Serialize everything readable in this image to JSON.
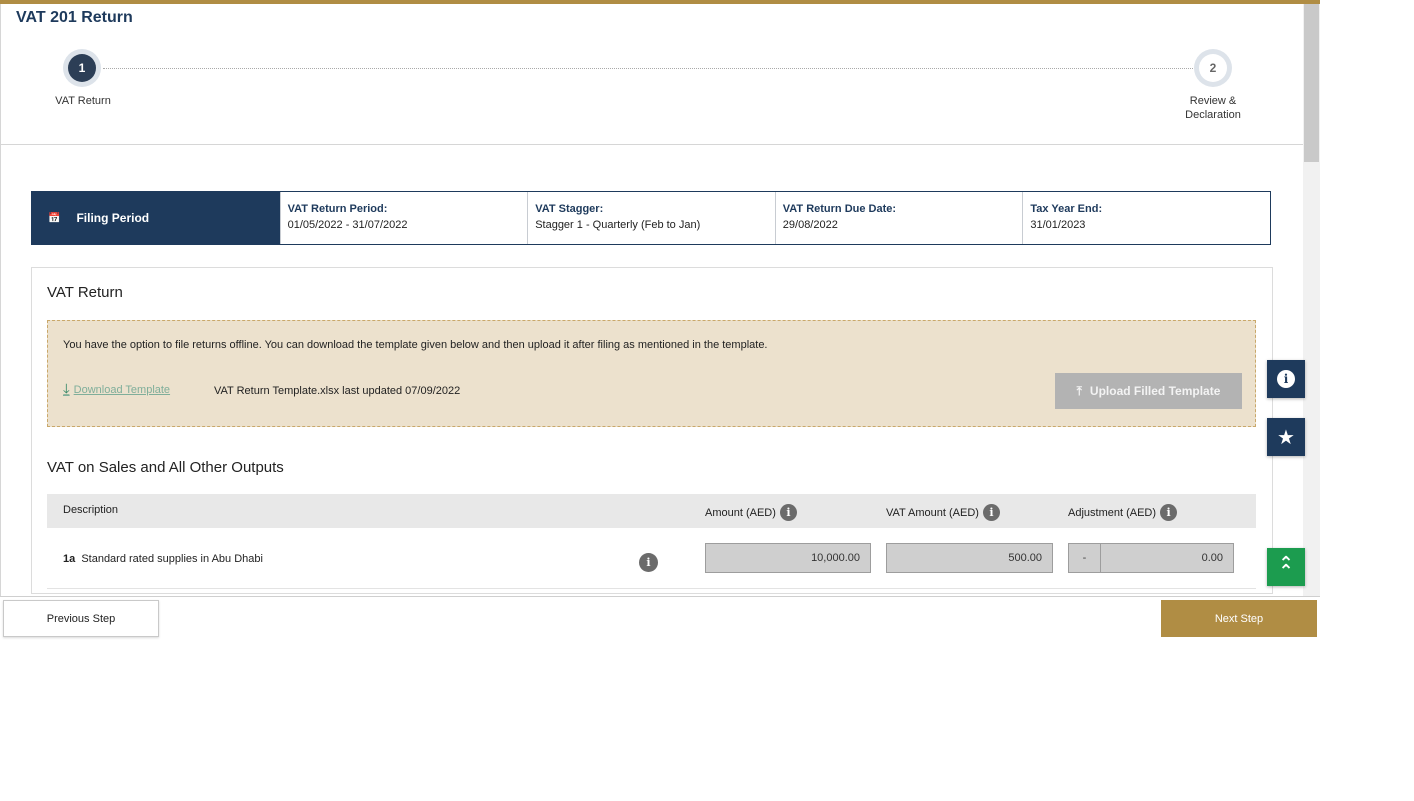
{
  "page": {
    "title": "VAT 201 Return"
  },
  "stepper": {
    "steps": [
      {
        "number": "1",
        "label": "VAT Return"
      },
      {
        "number": "2",
        "label": "Review & Declaration"
      }
    ]
  },
  "filing_period": {
    "header": "Filing Period",
    "icon": "calendar-icon",
    "fields": [
      {
        "label": "VAT Return Period:",
        "value": "01/05/2022 - 31/07/2022"
      },
      {
        "label": "VAT Stagger:",
        "value": "Stagger 1 - Quarterly (Feb to Jan)"
      },
      {
        "label": "VAT Return Due Date:",
        "value": "29/08/2022"
      },
      {
        "label": "Tax Year End:",
        "value": "31/01/2023"
      }
    ]
  },
  "vat_return": {
    "title": "VAT Return",
    "offline": {
      "message": "You have the option to file returns offline. You can download the template given below and then upload it after filing as mentioned in the template.",
      "download_label": "Download Template",
      "template_info": "VAT Return Template.xlsx last updated 07/09/2022",
      "upload_label": "Upload Filled Template"
    }
  },
  "sales": {
    "title": "VAT on Sales and All Other Outputs",
    "columns": {
      "description": "Description",
      "amount": "Amount (AED)",
      "vat_amount": "VAT Amount (AED)",
      "adjustment": "Adjustment (AED)"
    },
    "rows": [
      {
        "code": "1a",
        "label": "Standard rated supplies in Abu Dhabi",
        "amount": "10,000.00",
        "vat_amount": "500.00",
        "adjustment_sign": "-",
        "adjustment": "0.00"
      }
    ]
  },
  "side_buttons": {
    "info": "i",
    "star": "★",
    "top": "⌃"
  },
  "footer": {
    "previous_label": "Previous Step",
    "next_label": "Next Step"
  },
  "colors": {
    "primary": "#1e3a5c",
    "accent": "#b08d44",
    "success": "#1c9c4f"
  }
}
